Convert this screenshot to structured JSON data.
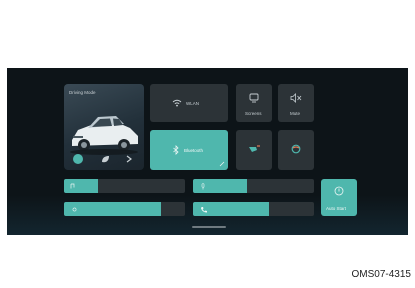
{
  "driving_mode": {
    "title": "Driving Mode"
  },
  "tiles": {
    "wlan": "WLAN",
    "screens": "Screens",
    "mute": "Mute",
    "bluetooth": "Bluetooth",
    "auto_start": "Auto Start"
  },
  "sliders": [
    {
      "icon": "music-note-icon",
      "level": 0.28
    },
    {
      "icon": "microphone-icon",
      "level": 0.45
    },
    {
      "icon": "brightness-icon",
      "level": 0.8
    },
    {
      "icon": "phone-icon",
      "level": 0.63
    }
  ],
  "footer_code": "OMS07-4315",
  "colors": {
    "accent": "#4fb7ad",
    "tile": "#2c3337",
    "background": "#0d1418"
  }
}
